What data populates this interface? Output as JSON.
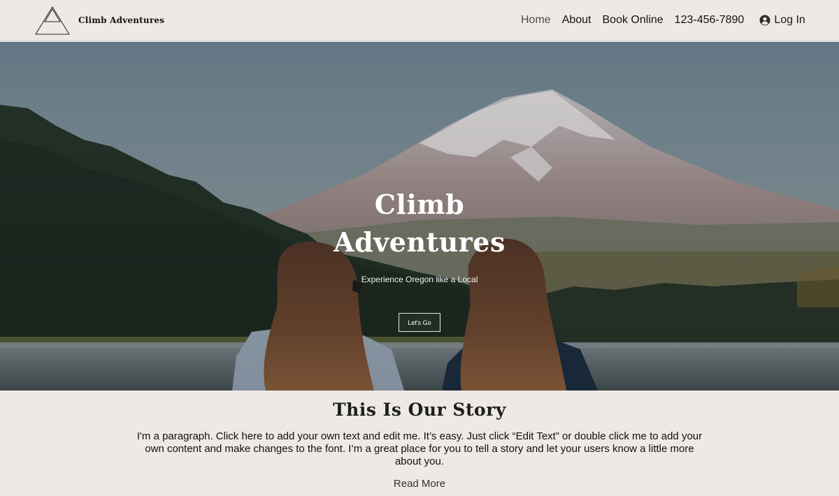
{
  "header": {
    "brand": "Climb Adventures",
    "nav": {
      "home": "Home",
      "about": "About",
      "book": "Book Online",
      "phone": "123-456-7890",
      "login": "Log In"
    }
  },
  "hero": {
    "title_line1": "Climb",
    "title_line2": "Adventures",
    "subtitle": "Experience Oregon like a Local",
    "button": "Let's Go"
  },
  "story": {
    "title": "This Is Our Story",
    "paragraph": "I'm a paragraph. Click here to add your own text and edit me. It’s easy. Just click “Edit Text” or double click me to add your own content and make changes to the font. I’m a great place for you to tell a story and let your users know a little more about you.",
    "read_more": "Read More"
  },
  "colors": {
    "page_background": "#ede9e5",
    "text": "#111111",
    "active_nav": "#4a4a4a"
  },
  "icons": [
    "logo-triangle-icon",
    "user-icon"
  ]
}
